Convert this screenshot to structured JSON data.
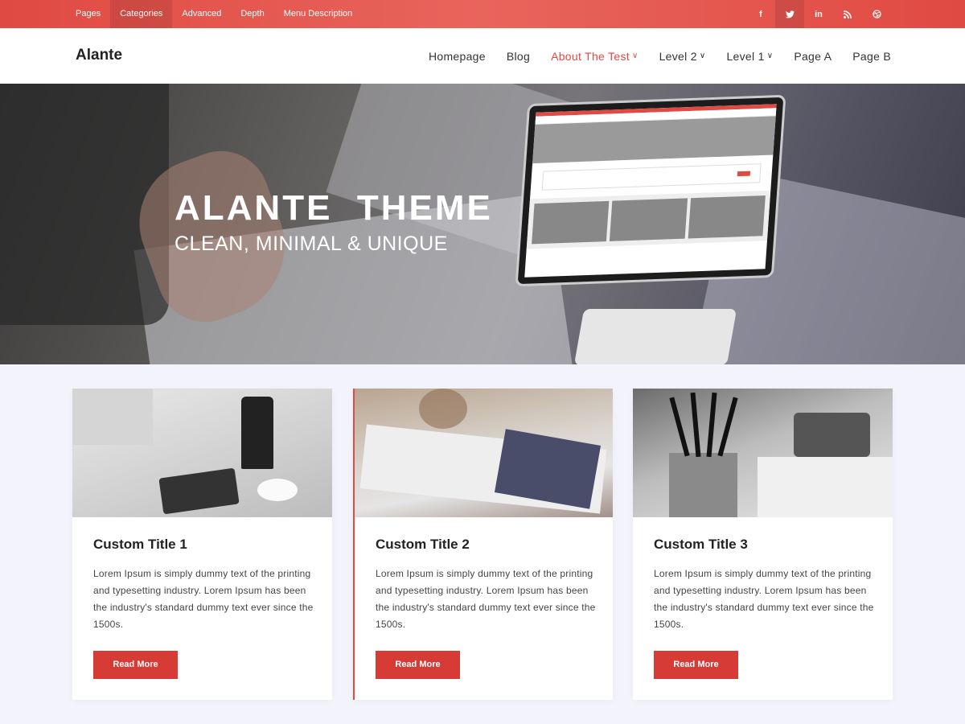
{
  "topbar": {
    "links": [
      "Pages",
      "Categories",
      "Advanced",
      "Depth",
      "Menu Description"
    ],
    "active_link_index": 1,
    "social_icons": [
      {
        "name": "facebook-icon",
        "glyph": "f"
      },
      {
        "name": "twitter-icon",
        "glyph": "t"
      },
      {
        "name": "linkedin-icon",
        "glyph": "in"
      },
      {
        "name": "rss-icon",
        "glyph": "⦿"
      },
      {
        "name": "dribbble-icon",
        "glyph": "◎"
      }
    ],
    "active_social_index": 1,
    "color": "#e04a43"
  },
  "header": {
    "logo": "Alante",
    "nav": [
      {
        "label": "Homepage",
        "dropdown": false
      },
      {
        "label": "Blog",
        "dropdown": false
      },
      {
        "label": "About The Test",
        "dropdown": true,
        "active": true
      },
      {
        "label": "Level 2",
        "dropdown": true
      },
      {
        "label": "Level 1",
        "dropdown": true
      },
      {
        "label": "Page A",
        "dropdown": false
      },
      {
        "label": "Page B",
        "dropdown": false
      }
    ],
    "caret": "∨"
  },
  "hero": {
    "title": "ALANTE  THEME",
    "subtitle": "CLEAN, MINIMAL & UNIQUE"
  },
  "cards": [
    {
      "title": "Custom Title 1",
      "text": "Lorem Ipsum is simply dummy text of the printing and typesetting industry. Lorem Ipsum has been the industry's standard dummy text ever since the 1500s.",
      "button": "Read More"
    },
    {
      "title": "Custom Title 2",
      "text": "Lorem Ipsum is simply dummy text of the printing and typesetting industry. Lorem Ipsum has been the industry's standard dummy text ever since the 1500s.",
      "button": "Read More"
    },
    {
      "title": "Custom Title 3",
      "text": "Lorem Ipsum is simply dummy text of the printing and typesetting industry. Lorem Ipsum has been the industry's standard dummy text ever since the 1500s.",
      "button": "Read More"
    }
  ],
  "colors": {
    "accent": "#e04a43",
    "button": "#d63c35",
    "page_bg": "#f3f3fb"
  }
}
